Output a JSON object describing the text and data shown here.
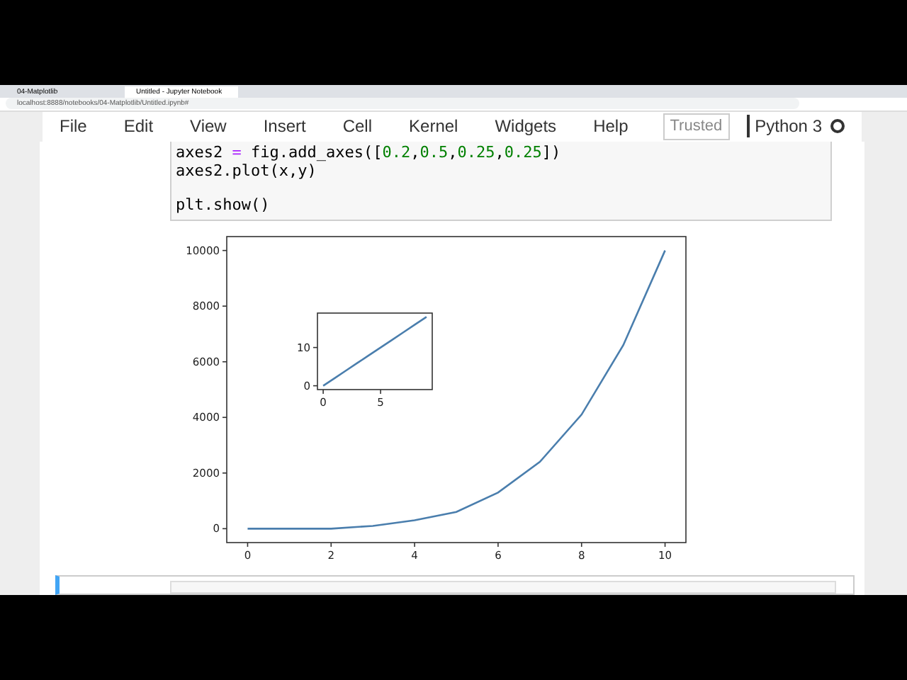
{
  "browser": {
    "tabs": [
      {
        "title": "04-Matplotlib",
        "selected": false
      },
      {
        "title": "Untitled - Jupyter Notebook",
        "selected": true
      }
    ],
    "url": "localhost:8888/notebooks/04-Matplotlib/Untitled.ipynb#"
  },
  "menu": [
    "File",
    "Edit",
    "View",
    "Insert",
    "Cell",
    "Kernel",
    "Widgets",
    "Help"
  ],
  "trusted": "Trusted",
  "kernel": "Python 3",
  "code_lines": [
    {
      "tokens": [
        {
          "t": "axes2 ",
          "kind": "name"
        },
        {
          "t": "=",
          "kind": "operator"
        },
        {
          "t": " fig.add_axes([",
          "kind": "name"
        },
        {
          "t": "0.2",
          "kind": "number"
        },
        {
          "t": ",",
          "kind": "name"
        },
        {
          "t": "0.5",
          "kind": "number"
        },
        {
          "t": ",",
          "kind": "name"
        },
        {
          "t": "0.25",
          "kind": "number"
        },
        {
          "t": ",",
          "kind": "name"
        },
        {
          "t": "0.25",
          "kind": "number"
        },
        {
          "t": "])",
          "kind": "name"
        }
      ]
    },
    {
      "tokens": [
        {
          "t": "axes2.plot(x,y)",
          "kind": "name"
        }
      ]
    },
    {
      "tokens": [
        {
          "t": "plt.show()",
          "kind": "name"
        }
      ]
    }
  ],
  "figure": {
    "chart_data": {
      "type": "line",
      "x": [
        0,
        1,
        2,
        3,
        4,
        5,
        6,
        7,
        8,
        9,
        10
      ],
      "series": [
        {
          "color": "#4a7ead",
          "values": [
            0,
            0,
            0,
            100,
            300,
            600,
            1300,
            2400,
            4100,
            6600,
            10000
          ]
        }
      ],
      "xlim": [
        -0.5,
        10.5
      ],
      "ylim": [
        -500,
        10500
      ],
      "xticks": [
        0,
        2,
        4,
        6,
        8,
        10
      ],
      "yticks": [
        0,
        2000,
        4000,
        6000,
        8000,
        10000
      ]
    },
    "inset": {
      "chart_data": {
        "type": "line",
        "x": [
          0,
          1,
          2,
          3,
          4,
          5,
          6,
          7,
          8,
          9
        ],
        "series": [
          {
            "color": "#4a7ead",
            "values": [
              0,
              2,
              4,
              6,
              8,
              10,
              12,
              14,
              16,
              18
            ]
          }
        ],
        "xlim": [
          -0.5,
          9.5
        ],
        "ylim": [
          -1,
          19
        ],
        "xticks": [
          0,
          5
        ],
        "yticks": [
          0,
          10
        ]
      }
    }
  }
}
